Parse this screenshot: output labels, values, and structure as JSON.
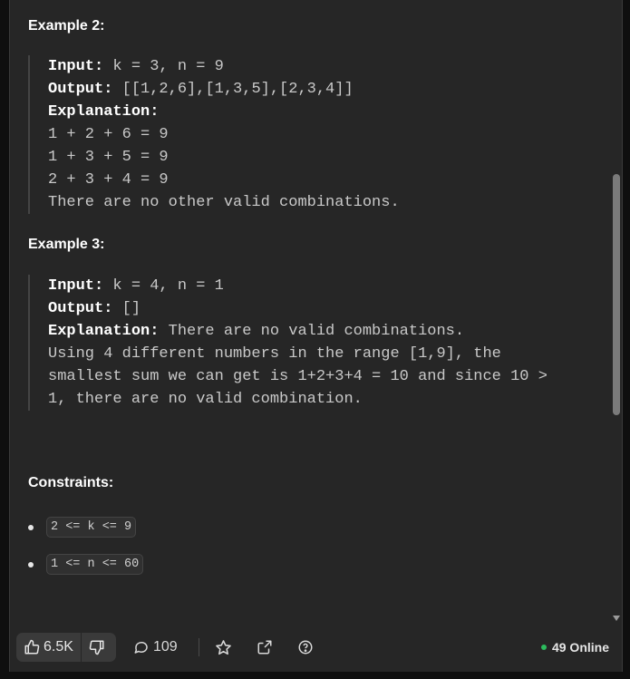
{
  "example2": {
    "title": "Example 2:",
    "input_label": "Input:",
    "input_value": " k = 3, n = 9",
    "output_label": "Output:",
    "output_value": " [[1,2,6],[1,3,5],[2,3,4]]",
    "explanation_label": "Explanation:",
    "lines": [
      "1 + 2 + 6 = 9",
      "1 + 3 + 5 = 9",
      "2 + 3 + 4 = 9",
      "There are no other valid combinations."
    ]
  },
  "example3": {
    "title": "Example 3:",
    "input_label": "Input:",
    "input_value": " k = 4, n = 1",
    "output_label": "Output:",
    "output_value": " []",
    "explanation_label": "Explanation:",
    "explanation_value": " There are no valid combinations.",
    "lines": [
      "Using 4 different numbers in the range [1,9], the",
      "smallest sum we can get is 1+2+3+4 = 10 and since 10 >",
      "1, there are no valid combination."
    ]
  },
  "constraints": {
    "title": "Constraints:",
    "items": [
      "2 <= k <= 9",
      "1 <= n <= 60"
    ]
  },
  "footer": {
    "likes": "6.5K",
    "comments": "109",
    "online": "49 Online",
    "icons": [
      "thumbs-up-icon",
      "thumbs-down-icon",
      "comment-icon",
      "star-icon",
      "share-icon",
      "help-icon"
    ],
    "online_color": "#2cbb5d"
  }
}
